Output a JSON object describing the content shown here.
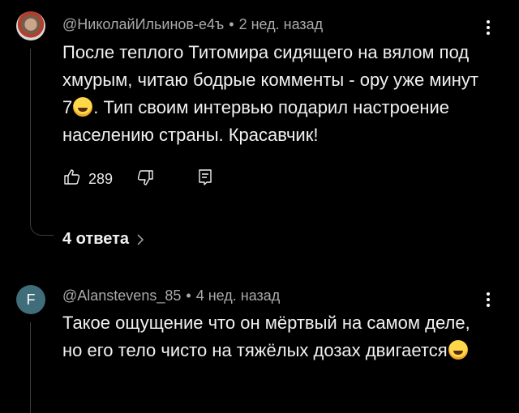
{
  "comments": [
    {
      "author": "@НиколайИльинов-е4ъ",
      "time": "2 нед. назад",
      "text_part1": "После теплого Титомира сидящего на вялом под хмурым, читаю бодрые комменты - ору уже минут 7",
      "emoji": "face-with-tears-of-joy",
      "text_part2": ". Тип своим интервью  подарил настроение населению страны. Красавчик!",
      "likes": "289",
      "replies_label": "4 ответа"
    },
    {
      "author": "@Alanstevens_85",
      "avatar_letter": "F",
      "avatar_color": "#3f6d7a",
      "time": "4 нед. назад",
      "text_part1": "Такое ощущение что он мёртвый на самом деле, но его тело чисто на тяжёлых дозах двигается",
      "emoji": "face-with-tears-of-joy"
    }
  ],
  "separator": "•"
}
